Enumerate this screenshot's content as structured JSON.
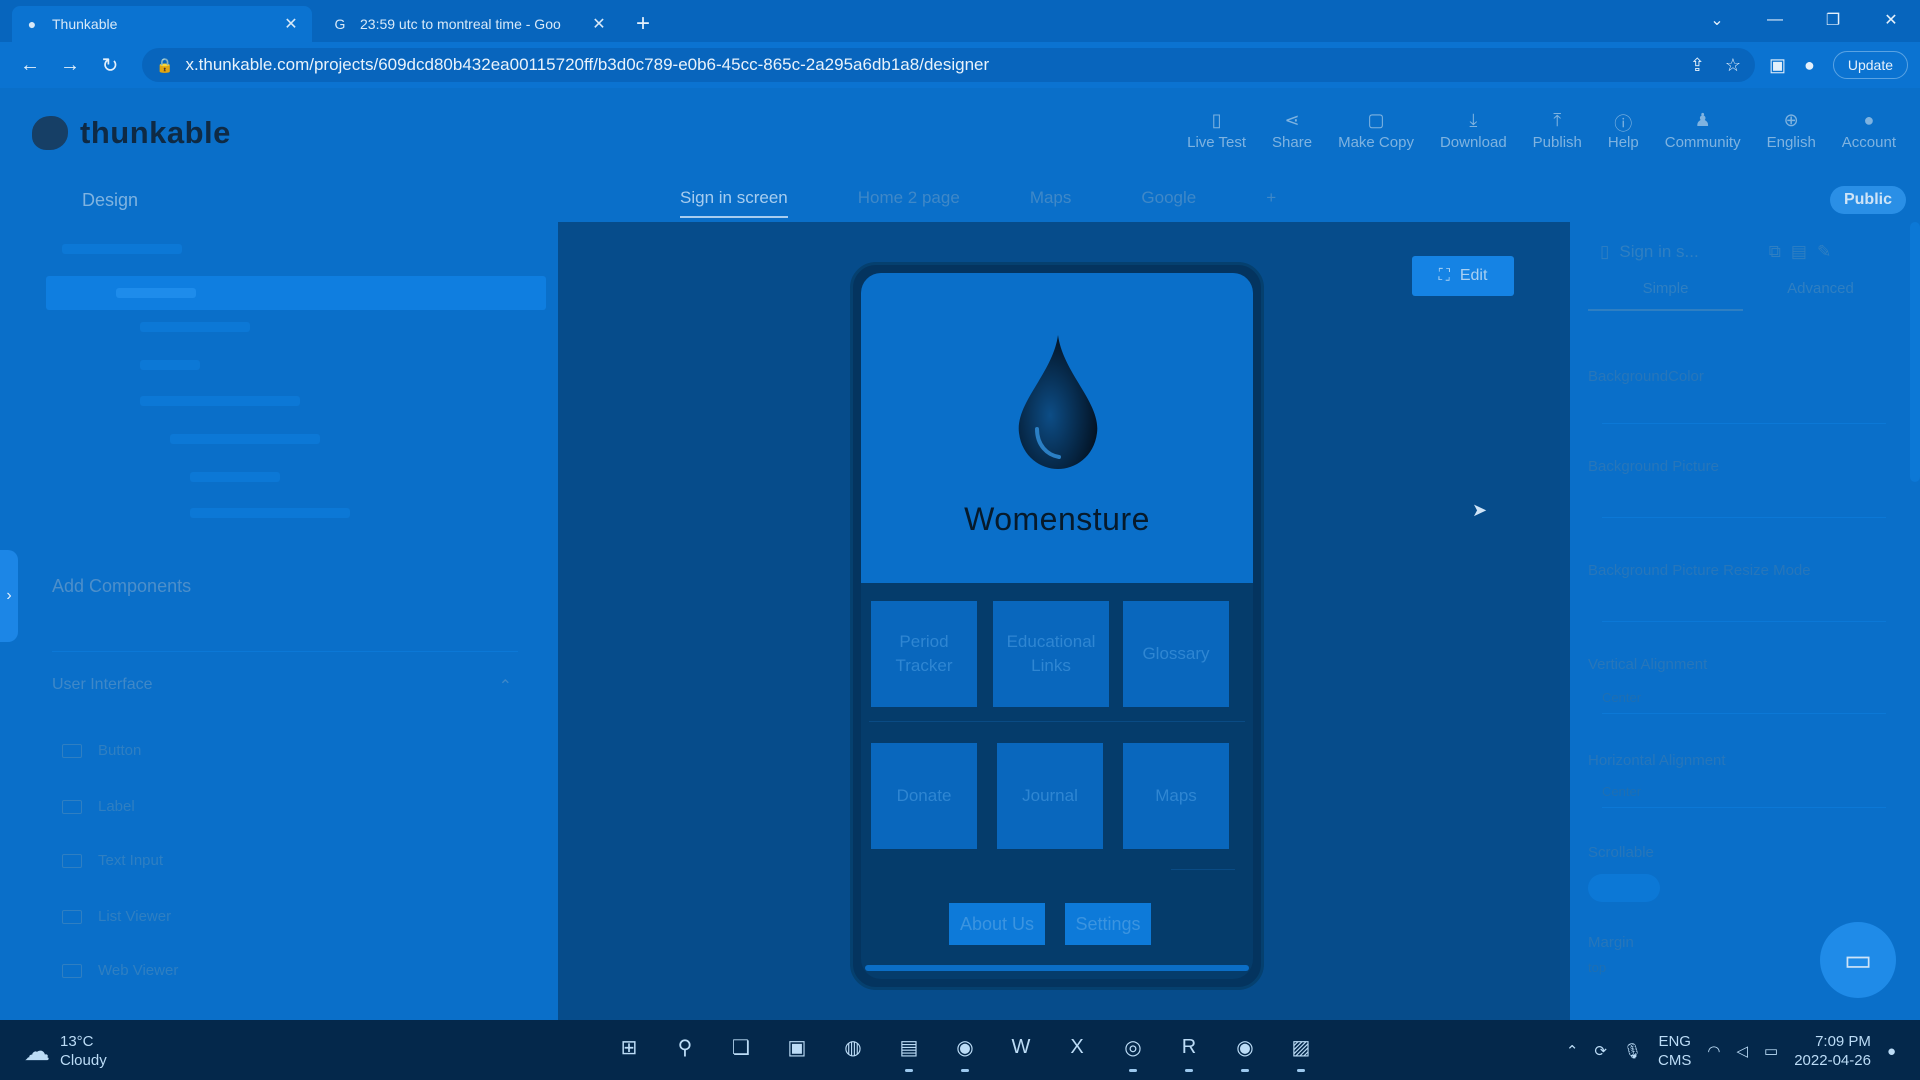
{
  "browser": {
    "tabs": [
      {
        "title": "Thunkable",
        "active": true
      },
      {
        "title": "23:59 utc to montreal time - Goo",
        "active": false
      }
    ],
    "url": "x.thunkable.com/projects/609dcd80b432ea00115720ff/b3d0c789-e0b6-45cc-865c-2a295a6db1a8/designer",
    "update_label": "Update"
  },
  "app": {
    "logo_text": "thunkable",
    "toolbar": [
      {
        "label": "Live Test",
        "icon": "phone-icon"
      },
      {
        "label": "Share",
        "icon": "share-icon"
      },
      {
        "label": "Make Copy",
        "icon": "copy-icon"
      },
      {
        "label": "Download",
        "icon": "download-icon"
      },
      {
        "label": "Publish",
        "icon": "publish-icon"
      },
      {
        "label": "Help",
        "icon": "help-icon"
      },
      {
        "label": "Community",
        "icon": "community-icon"
      },
      {
        "label": "English",
        "icon": "globe-icon"
      },
      {
        "label": "Account",
        "icon": "account-icon"
      }
    ],
    "public_label": "Public"
  },
  "left_panel": {
    "title": "Design",
    "add_components": "Add Components",
    "section": "User Interface",
    "components": [
      "Button",
      "Label",
      "Text Input",
      "List Viewer",
      "Web Viewer"
    ]
  },
  "screen_tabs": [
    "Sign in screen",
    "Home 2 page",
    "Maps",
    "Google"
  ],
  "canvas": {
    "edit_label": "Edit",
    "app_title": "Womensture",
    "grid_buttons": [
      [
        "Period",
        "Tracker"
      ],
      [
        "Educational",
        "Links"
      ],
      [
        "Glossary"
      ],
      [
        "Donate"
      ],
      [
        "Journal"
      ],
      [
        "Maps"
      ]
    ],
    "footer_buttons": [
      "About Us",
      "Settings"
    ]
  },
  "right_panel": {
    "header": "Sign in s...",
    "tabs": [
      "Simple",
      "Advanced"
    ],
    "properties": [
      {
        "label": "BackgroundColor",
        "value": ""
      },
      {
        "label": "Background Picture",
        "value": ""
      },
      {
        "label": "Background Picture Resize Mode",
        "value": ""
      },
      {
        "label": "Vertical Alignment",
        "value": "Center"
      },
      {
        "label": "Horizontal Alignment",
        "value": "Center"
      },
      {
        "label": "Scrollable",
        "value": ""
      },
      {
        "label": "Margin",
        "value": "top"
      }
    ]
  },
  "taskbar": {
    "temp": "13°C",
    "weather": "Cloudy",
    "lang1": "ENG",
    "lang2": "CMS",
    "time": "7:09 PM",
    "date": "2022-04-26"
  }
}
